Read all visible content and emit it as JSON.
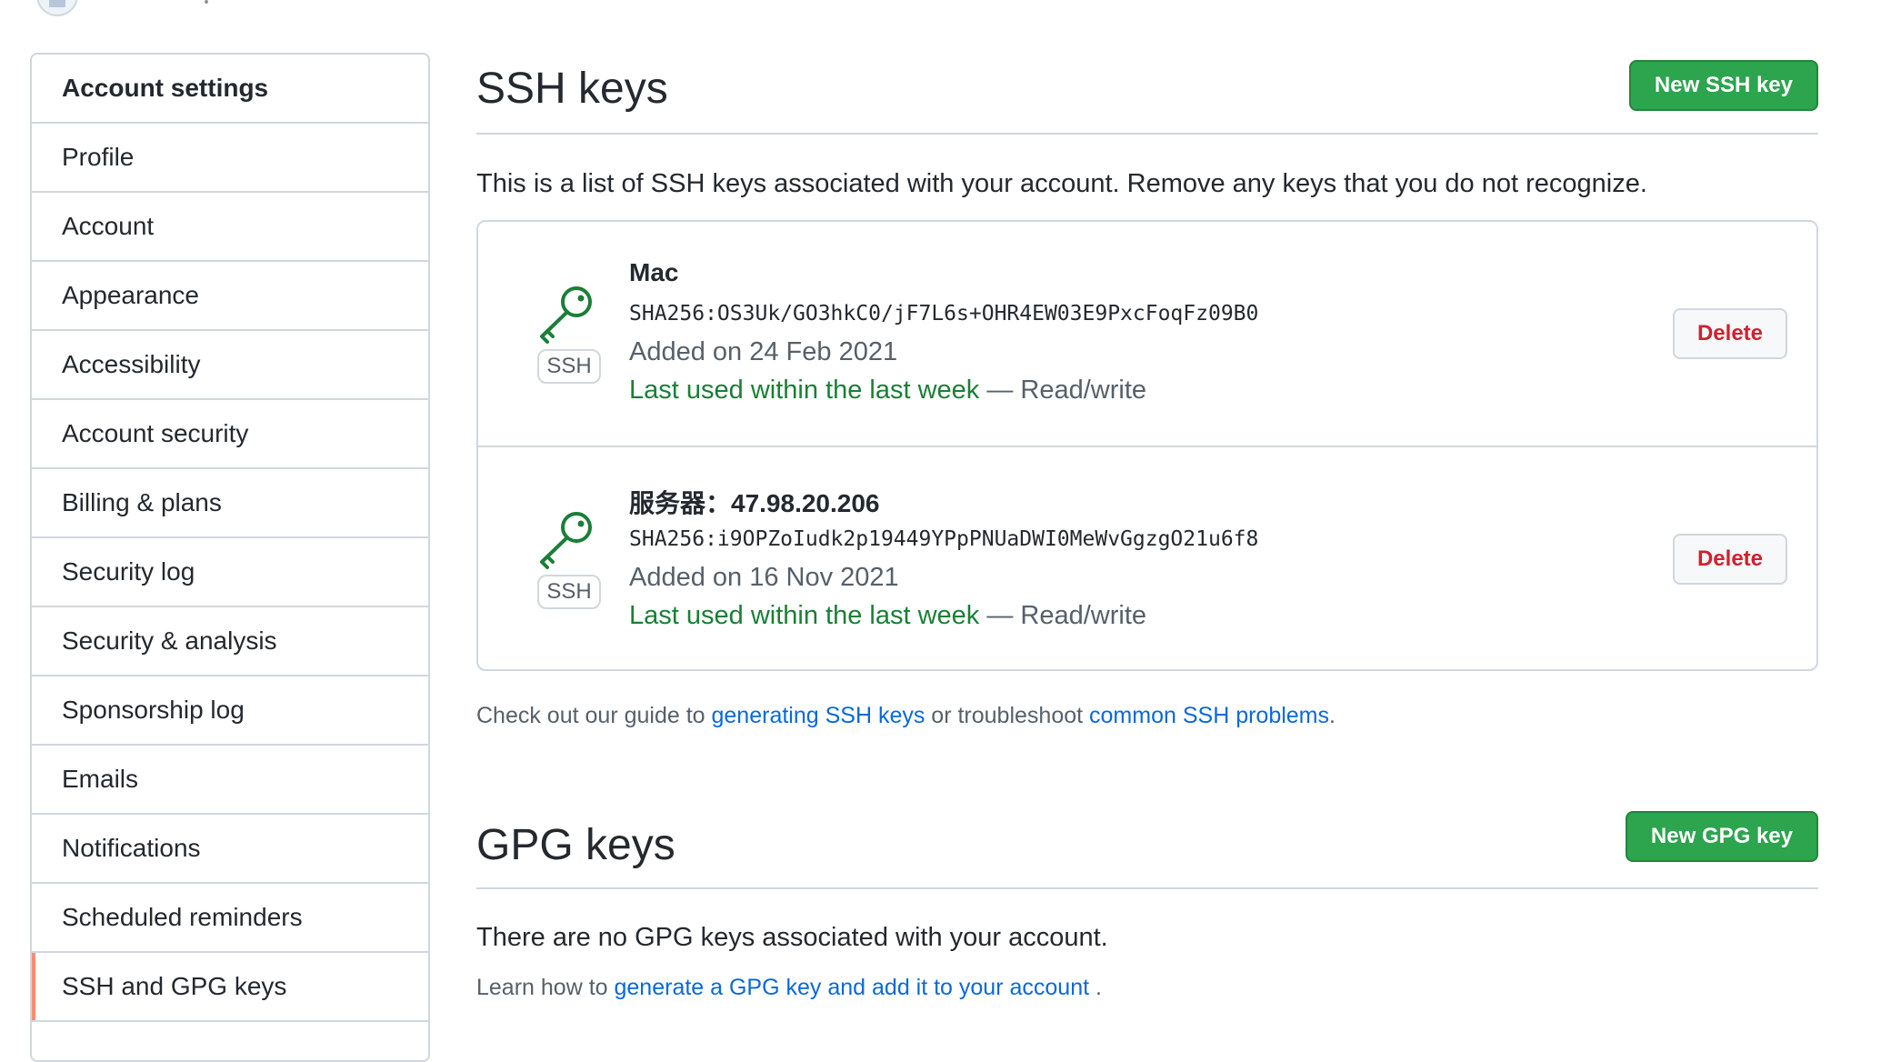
{
  "sidebar": {
    "items": [
      {
        "label": "Account settings",
        "header": true
      },
      {
        "label": "Profile"
      },
      {
        "label": "Account"
      },
      {
        "label": "Appearance"
      },
      {
        "label": "Accessibility"
      },
      {
        "label": "Account security"
      },
      {
        "label": "Billing & plans"
      },
      {
        "label": "Security log"
      },
      {
        "label": "Security & analysis"
      },
      {
        "label": "Sponsorship log"
      },
      {
        "label": "Emails"
      },
      {
        "label": "Notifications"
      },
      {
        "label": "Scheduled reminders"
      },
      {
        "label": "SSH and GPG keys",
        "active": true
      }
    ],
    "active_indicator_color": "#fd8c73"
  },
  "ssh": {
    "title": "SSH keys",
    "new_button": "New SSH key",
    "description": "This is a list of SSH keys associated with your account. Remove any keys that you do not recognize.",
    "keys": [
      {
        "title": "Mac",
        "fingerprint": "SHA256:OS3Uk/GO3hkC0/jF7L6s+OHR4EW03E9PxcFoqFz09B0",
        "added": "Added on 24 Feb 2021",
        "last_used": "Last used within the last week",
        "access": " — Read/write",
        "badge": "SSH",
        "delete_label": "Delete"
      },
      {
        "title": "服务器：47.98.20.206",
        "fingerprint": "SHA256:i9OPZoIudk2p19449YPpPNUaDWI0MeWvGgzgO21u6f8",
        "added": "Added on 16 Nov 2021",
        "last_used": "Last used within the last week",
        "access": " — Read/write",
        "badge": "SSH",
        "delete_label": "Delete"
      }
    ],
    "guide": {
      "prefix": "Check out our guide to ",
      "link1": "generating SSH keys",
      "middle": " or troubleshoot ",
      "link2": "common SSH problems",
      "suffix": "."
    }
  },
  "gpg": {
    "title": "GPG keys",
    "new_button": "New GPG key",
    "empty_text": "There are no GPG keys associated with your account.",
    "learn_prefix": "Learn how to ",
    "learn_link": "generate a GPG key and add it to your account",
    "learn_suffix": " ."
  },
  "colors": {
    "primary_button": "#2da44e",
    "danger": "#cf222e",
    "link": "#0969da",
    "success_text": "#1a7f37"
  },
  "icons": {
    "key": "key-icon"
  }
}
